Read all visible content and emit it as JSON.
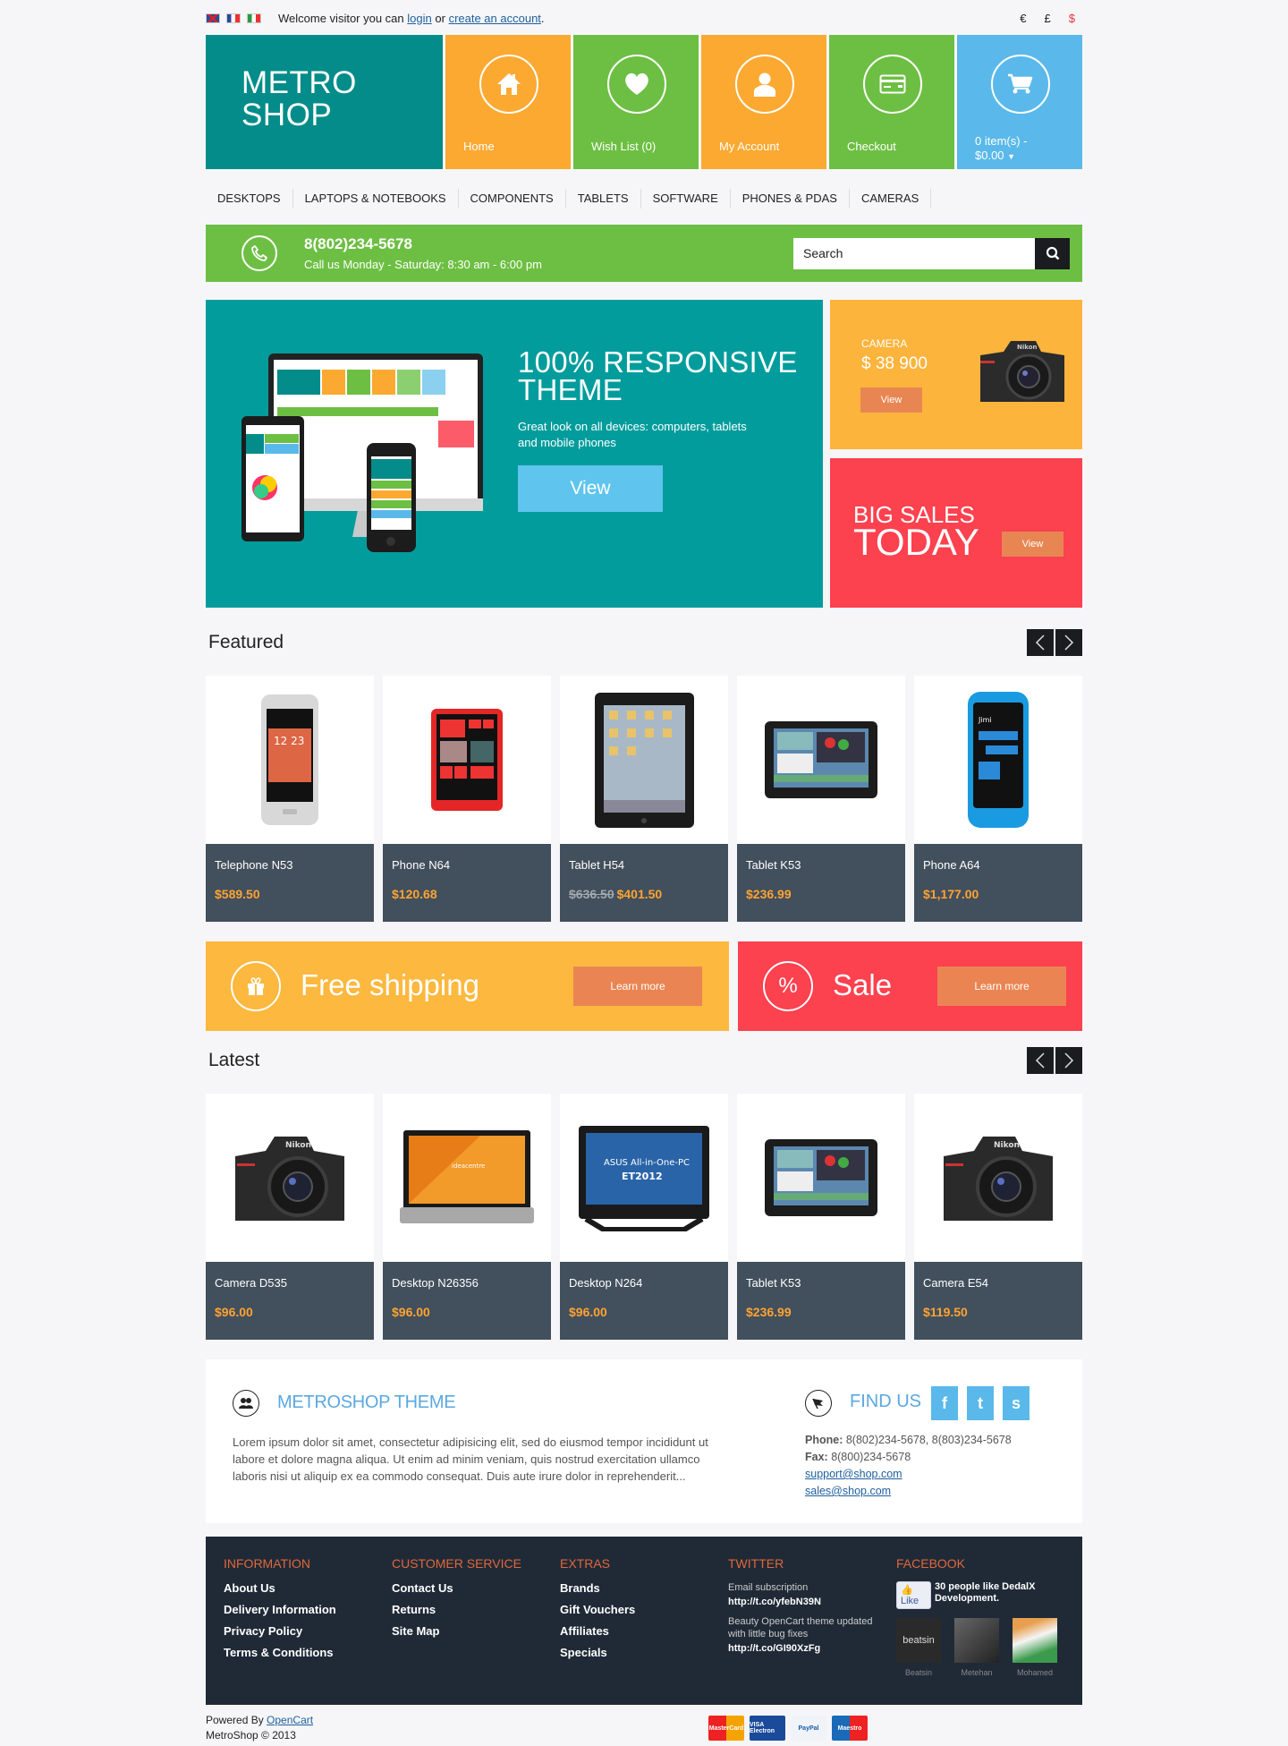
{
  "topbar": {
    "flags": [
      "uk-flag",
      "fr-flag",
      "it-flag"
    ],
    "welcome_prefix": "Welcome visitor you can",
    "login_label": "login",
    "or_label": "or",
    "create_account_label": "create an account",
    "period": ".",
    "currencies": [
      {
        "symbol": "€",
        "active": false
      },
      {
        "symbol": "£",
        "active": false
      },
      {
        "symbol": "$",
        "active": true
      }
    ]
  },
  "header": {
    "logo_line1": "METRO",
    "logo_line2": "SHOP",
    "tiles": [
      {
        "label": "Home",
        "icon": "home-icon",
        "color": "#fca932"
      },
      {
        "label": "Wish List (0)",
        "icon": "heart-icon",
        "color": "#6dbf43"
      },
      {
        "label": "My Account",
        "icon": "user-icon",
        "color": "#fca932"
      },
      {
        "label": "Checkout",
        "icon": "credit-card-icon",
        "color": "#6dbf43"
      },
      {
        "label_line1": "0 item(s) -",
        "label_line2": "$0.00",
        "icon": "cart-icon",
        "color": "#5ab9ea"
      }
    ]
  },
  "menu": [
    "DESKTOPS",
    "LAPTOPS & NOTEBOOKS",
    "COMPONENTS",
    "TABLETS",
    "SOFTWARE",
    "PHONES & PDAS",
    "CAMERAS"
  ],
  "callbar": {
    "phone": "8(802)234-5678",
    "hours": "Call us Monday - Saturday: 8:30 am - 6:00 pm",
    "search_placeholder": "Search"
  },
  "hero": {
    "title_line1": "100% RESPONSIVE",
    "title_line2": "THEME",
    "description": "Great look on all devices: computers, tablets and mobile phones",
    "button": "View"
  },
  "promo_camera": {
    "category": "CAMERA",
    "price": "$ 38 900",
    "button": "View"
  },
  "promo_sales": {
    "line1": "BIG SALES",
    "line2": "TODAY",
    "button": "View"
  },
  "featured": {
    "title": "Featured",
    "products": [
      {
        "name": "Telephone N53",
        "price": "$589.50",
        "old_price": null,
        "image": "phone-silver"
      },
      {
        "name": "Phone N64",
        "price": "$120.68",
        "old_price": null,
        "image": "phone-red"
      },
      {
        "name": "Tablet H54",
        "price": "$401.50",
        "old_price": "$636.50",
        "image": "tablet-portrait"
      },
      {
        "name": "Tablet K53",
        "price": "$236.99",
        "old_price": null,
        "image": "tablet-landscape"
      },
      {
        "name": "Phone A64",
        "price": "$1,177.00",
        "old_price": null,
        "image": "phone-blue"
      }
    ]
  },
  "banners": {
    "shipping": {
      "title": "Free shipping",
      "button": "Learn more",
      "icon": "gift-icon"
    },
    "sale": {
      "title": "Sale",
      "button": "Learn more",
      "icon": "percent-icon",
      "symbol": "%"
    }
  },
  "latest": {
    "title": "Latest",
    "products": [
      {
        "name": "Camera D535",
        "price": "$96.00",
        "image": "camera"
      },
      {
        "name": "Desktop N26356",
        "price": "$96.00",
        "image": "desktop-orange"
      },
      {
        "name": "Desktop N264",
        "price": "$96.00",
        "image": "desktop-blue"
      },
      {
        "name": "Tablet K53",
        "price": "$236.99",
        "image": "tablet-landscape"
      },
      {
        "name": "Camera E54",
        "price": "$119.50",
        "image": "camera"
      }
    ]
  },
  "about": {
    "title": "METROSHOP THEME",
    "text": "Lorem ipsum dolor sit amet, consectetur adipisicing elit, sed do eiusmod tempor incididunt ut labore et dolore magna aliqua. Ut enim ad minim veniam, quis nostrud exercitation ullamco laboris nisi ut aliquip ex ea commodo consequat. Duis aute irure dolor in reprehenderit..."
  },
  "find_us": {
    "title": "FIND US",
    "social": [
      "f",
      "t",
      "s"
    ],
    "phone_label": "Phone:",
    "phone_value": "8(802)234-5678, 8(803)234-5678",
    "fax_label": "Fax:",
    "fax_value": "8(800)234-5678",
    "emails": [
      "support@shop.com",
      "sales@shop.com"
    ]
  },
  "footer": {
    "columns": [
      {
        "title": "INFORMATION",
        "links": [
          "About Us",
          "Delivery Information",
          "Privacy Policy",
          "Terms & Conditions"
        ]
      },
      {
        "title": "CUSTOMER SERVICE",
        "links": [
          "Contact Us",
          "Returns",
          "Site Map"
        ]
      },
      {
        "title": "EXTRAS",
        "links": [
          "Brands",
          "Gift Vouchers",
          "Affiliates",
          "Specials"
        ]
      }
    ],
    "twitter": {
      "title": "TWITTER",
      "tweets": [
        {
          "text": "Email subscription",
          "link": "http://t.co/yfebN39N"
        },
        {
          "text": "Beauty OpenCart theme updated with little bug fixes",
          "link": "http://t.co/GI90XzFg"
        }
      ]
    },
    "facebook": {
      "title": "FACEBOOK",
      "like_label": "Like",
      "likes_text": "30 people like DedalX Development.",
      "fans": [
        "Beatsin",
        "Metehan",
        "Mohamed"
      ]
    }
  },
  "bottom": {
    "powered_by": "Powered By",
    "opencart": "OpenCart",
    "copyright": "MetroShop © 2013",
    "payments": [
      "MasterCard",
      "VISA Electron",
      "PayPal",
      "Maestro"
    ]
  }
}
